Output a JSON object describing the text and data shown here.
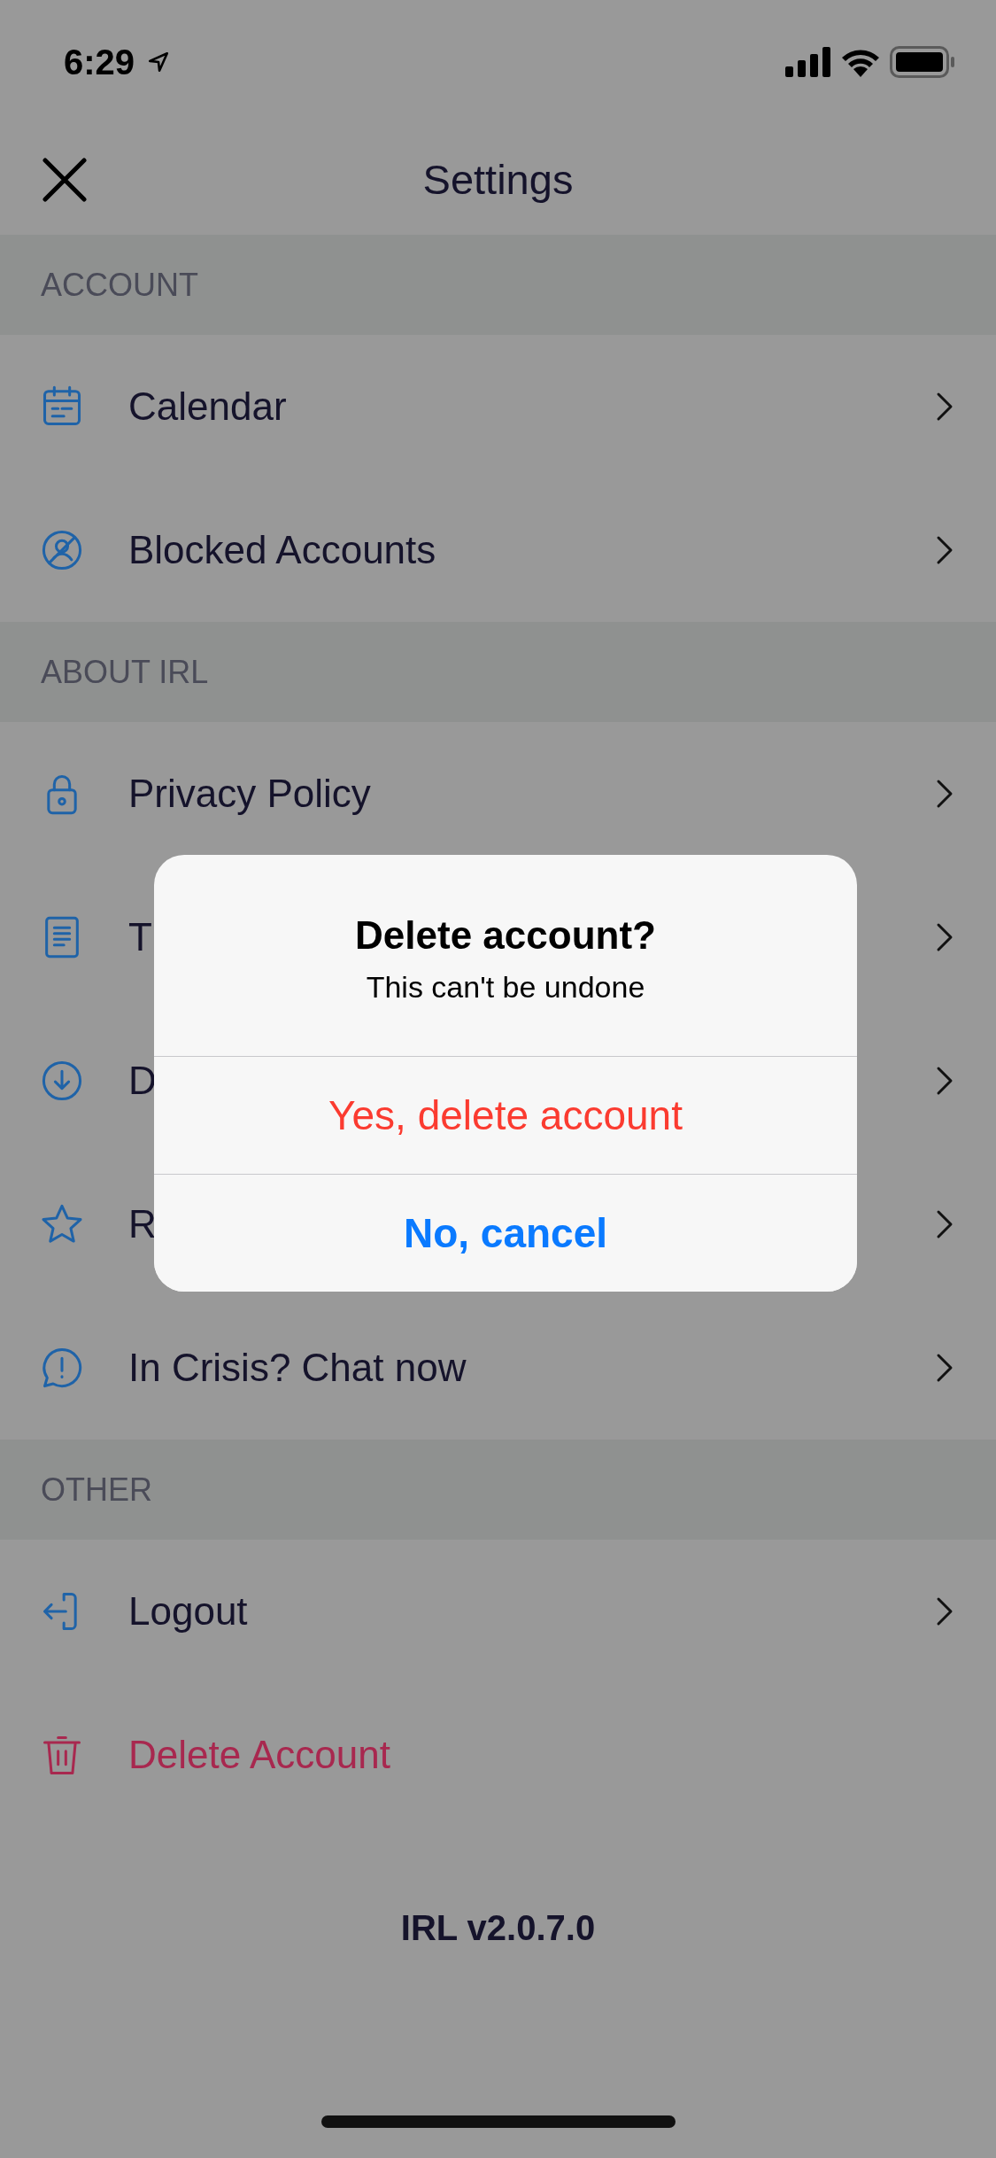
{
  "status_bar": {
    "time": "6:29"
  },
  "nav": {
    "title": "Settings"
  },
  "sections": [
    {
      "title": "ACCOUNT",
      "items": [
        {
          "label": "Calendar",
          "kind": "link"
        },
        {
          "label": "Blocked Accounts",
          "kind": "link"
        }
      ]
    },
    {
      "title": "ABOUT IRL",
      "items": [
        {
          "label": "Privacy Policy",
          "kind": "link"
        },
        {
          "label": "T",
          "kind": "link"
        },
        {
          "label": "D",
          "kind": "link"
        },
        {
          "label": "R",
          "kind": "link"
        },
        {
          "label": "In Crisis? Chat now",
          "kind": "link"
        }
      ]
    },
    {
      "title": "OTHER",
      "items": [
        {
          "label": "Logout",
          "kind": "link"
        },
        {
          "label": "Delete Account",
          "kind": "danger"
        }
      ]
    }
  ],
  "version": "IRL v2.0.7.0",
  "alert": {
    "title": "Delete account?",
    "message": "This can't be undone",
    "actions": [
      {
        "label": "Yes, delete account",
        "kind": "destructive"
      },
      {
        "label": "No, cancel",
        "kind": "cancel"
      }
    ]
  }
}
